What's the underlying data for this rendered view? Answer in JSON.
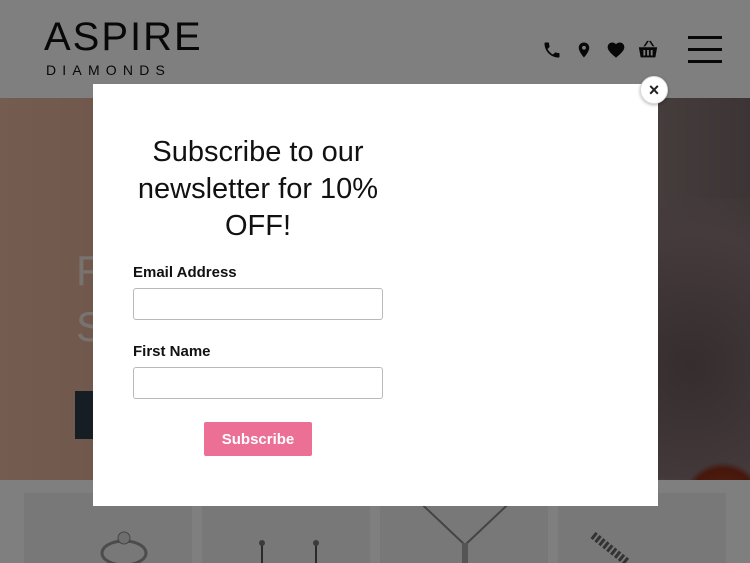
{
  "header": {
    "logo_main": "ASPIRE",
    "logo_sub": "DIAMONDS",
    "icons": [
      "phone-icon",
      "location-icon",
      "heart-icon",
      "basket-icon"
    ],
    "menu_icon": "hamburger-menu-icon"
  },
  "hero": {
    "line1": "F",
    "line2": "S"
  },
  "modal": {
    "title": "Subscribe to our newsletter for 10% OFF!",
    "email_label": "Email Address",
    "email_value": "",
    "first_name_label": "First Name",
    "first_name_value": "",
    "subscribe_label": "Subscribe",
    "close_symbol": "×"
  },
  "colors": {
    "subscribe_button": "#ec6f96",
    "hero_button": "#2c3a48",
    "overlay": "rgba(0,0,0,0.5)"
  }
}
